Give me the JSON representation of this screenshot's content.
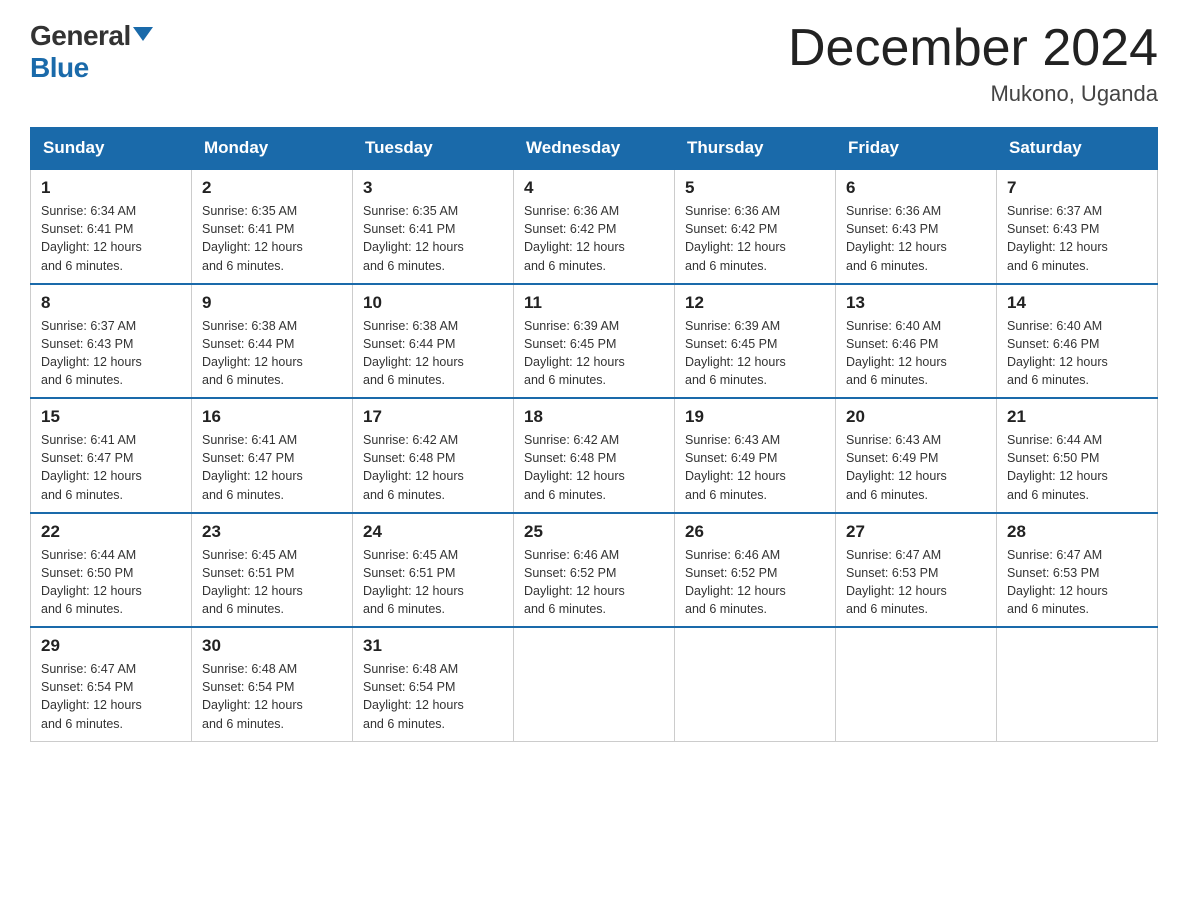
{
  "logo": {
    "general": "General",
    "blue": "Blue"
  },
  "title": "December 2024",
  "location": "Mukono, Uganda",
  "days_of_week": [
    "Sunday",
    "Monday",
    "Tuesday",
    "Wednesday",
    "Thursday",
    "Friday",
    "Saturday"
  ],
  "weeks": [
    [
      {
        "day": "1",
        "sunrise": "6:34 AM",
        "sunset": "6:41 PM",
        "daylight": "12 hours and 6 minutes."
      },
      {
        "day": "2",
        "sunrise": "6:35 AM",
        "sunset": "6:41 PM",
        "daylight": "12 hours and 6 minutes."
      },
      {
        "day": "3",
        "sunrise": "6:35 AM",
        "sunset": "6:41 PM",
        "daylight": "12 hours and 6 minutes."
      },
      {
        "day": "4",
        "sunrise": "6:36 AM",
        "sunset": "6:42 PM",
        "daylight": "12 hours and 6 minutes."
      },
      {
        "day": "5",
        "sunrise": "6:36 AM",
        "sunset": "6:42 PM",
        "daylight": "12 hours and 6 minutes."
      },
      {
        "day": "6",
        "sunrise": "6:36 AM",
        "sunset": "6:43 PM",
        "daylight": "12 hours and 6 minutes."
      },
      {
        "day": "7",
        "sunrise": "6:37 AM",
        "sunset": "6:43 PM",
        "daylight": "12 hours and 6 minutes."
      }
    ],
    [
      {
        "day": "8",
        "sunrise": "6:37 AM",
        "sunset": "6:43 PM",
        "daylight": "12 hours and 6 minutes."
      },
      {
        "day": "9",
        "sunrise": "6:38 AM",
        "sunset": "6:44 PM",
        "daylight": "12 hours and 6 minutes."
      },
      {
        "day": "10",
        "sunrise": "6:38 AM",
        "sunset": "6:44 PM",
        "daylight": "12 hours and 6 minutes."
      },
      {
        "day": "11",
        "sunrise": "6:39 AM",
        "sunset": "6:45 PM",
        "daylight": "12 hours and 6 minutes."
      },
      {
        "day": "12",
        "sunrise": "6:39 AM",
        "sunset": "6:45 PM",
        "daylight": "12 hours and 6 minutes."
      },
      {
        "day": "13",
        "sunrise": "6:40 AM",
        "sunset": "6:46 PM",
        "daylight": "12 hours and 6 minutes."
      },
      {
        "day": "14",
        "sunrise": "6:40 AM",
        "sunset": "6:46 PM",
        "daylight": "12 hours and 6 minutes."
      }
    ],
    [
      {
        "day": "15",
        "sunrise": "6:41 AM",
        "sunset": "6:47 PM",
        "daylight": "12 hours and 6 minutes."
      },
      {
        "day": "16",
        "sunrise": "6:41 AM",
        "sunset": "6:47 PM",
        "daylight": "12 hours and 6 minutes."
      },
      {
        "day": "17",
        "sunrise": "6:42 AM",
        "sunset": "6:48 PM",
        "daylight": "12 hours and 6 minutes."
      },
      {
        "day": "18",
        "sunrise": "6:42 AM",
        "sunset": "6:48 PM",
        "daylight": "12 hours and 6 minutes."
      },
      {
        "day": "19",
        "sunrise": "6:43 AM",
        "sunset": "6:49 PM",
        "daylight": "12 hours and 6 minutes."
      },
      {
        "day": "20",
        "sunrise": "6:43 AM",
        "sunset": "6:49 PM",
        "daylight": "12 hours and 6 minutes."
      },
      {
        "day": "21",
        "sunrise": "6:44 AM",
        "sunset": "6:50 PM",
        "daylight": "12 hours and 6 minutes."
      }
    ],
    [
      {
        "day": "22",
        "sunrise": "6:44 AM",
        "sunset": "6:50 PM",
        "daylight": "12 hours and 6 minutes."
      },
      {
        "day": "23",
        "sunrise": "6:45 AM",
        "sunset": "6:51 PM",
        "daylight": "12 hours and 6 minutes."
      },
      {
        "day": "24",
        "sunrise": "6:45 AM",
        "sunset": "6:51 PM",
        "daylight": "12 hours and 6 minutes."
      },
      {
        "day": "25",
        "sunrise": "6:46 AM",
        "sunset": "6:52 PM",
        "daylight": "12 hours and 6 minutes."
      },
      {
        "day": "26",
        "sunrise": "6:46 AM",
        "sunset": "6:52 PM",
        "daylight": "12 hours and 6 minutes."
      },
      {
        "day": "27",
        "sunrise": "6:47 AM",
        "sunset": "6:53 PM",
        "daylight": "12 hours and 6 minutes."
      },
      {
        "day": "28",
        "sunrise": "6:47 AM",
        "sunset": "6:53 PM",
        "daylight": "12 hours and 6 minutes."
      }
    ],
    [
      {
        "day": "29",
        "sunrise": "6:47 AM",
        "sunset": "6:54 PM",
        "daylight": "12 hours and 6 minutes."
      },
      {
        "day": "30",
        "sunrise": "6:48 AM",
        "sunset": "6:54 PM",
        "daylight": "12 hours and 6 minutes."
      },
      {
        "day": "31",
        "sunrise": "6:48 AM",
        "sunset": "6:54 PM",
        "daylight": "12 hours and 6 minutes."
      },
      null,
      null,
      null,
      null
    ]
  ]
}
